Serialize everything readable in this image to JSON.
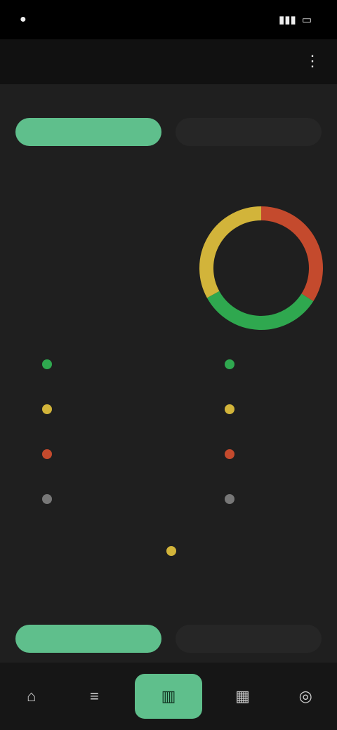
{
  "status": {
    "time": "",
    "signal_icon": "signal-icon",
    "battery": ""
  },
  "header": {
    "title": "",
    "menu_icon": "more-vertical-icon"
  },
  "section1": {
    "title": "",
    "toggle_active": "",
    "toggle_inactive": ""
  },
  "compare": {
    "left_header": "",
    "right_header": "",
    "left_center": "",
    "vs": "",
    "right_center": "",
    "left_legend": [
      {
        "label": "",
        "value": "",
        "color": "#2fa84f"
      },
      {
        "label": "",
        "value": "",
        "color": "#d2b43a"
      },
      {
        "label": "",
        "value": "",
        "color": "#c44a2d"
      },
      {
        "label": "",
        "value": "",
        "color": "#777777"
      }
    ],
    "right_legend": [
      {
        "label": "",
        "value": "",
        "color": "#2fa84f"
      },
      {
        "label": "",
        "value": "",
        "color": "#d2b43a"
      },
      {
        "label": "",
        "value": "",
        "color": "#c44a2d"
      },
      {
        "label": "",
        "value": "",
        "color": "#777777"
      }
    ],
    "note": "",
    "note_dot_color": "#d2b43a"
  },
  "donut": {
    "green": 0.33,
    "yellow": 0.33,
    "red": 0.34
  },
  "section2": {
    "title": "",
    "toggle_active": "",
    "toggle_inactive": ""
  },
  "bottom_nav": [
    {
      "icon": "home-icon"
    },
    {
      "icon": "list-icon"
    },
    {
      "icon": "chart-icon"
    },
    {
      "icon": "calendar-icon"
    },
    {
      "icon": "profile-icon"
    }
  ],
  "colors": {
    "accent": "#5fbf8c",
    "bg": "#1f1f1f"
  }
}
